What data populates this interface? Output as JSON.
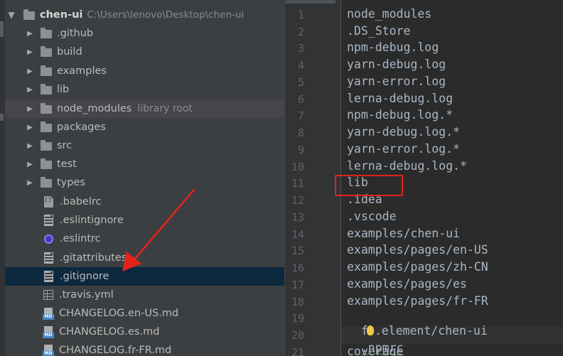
{
  "tree": {
    "root": {
      "name": "chen-ui",
      "path": "C:\\Users\\lenovo\\Desktop\\chen-ui"
    },
    "folders": [
      {
        "label": ".github"
      },
      {
        "label": "build"
      },
      {
        "label": "examples"
      },
      {
        "label": "lib"
      },
      {
        "label": "node_modules",
        "hint": "library root"
      },
      {
        "label": "packages"
      },
      {
        "label": "src"
      },
      {
        "label": "test"
      },
      {
        "label": "types"
      }
    ],
    "files": [
      {
        "label": ".babelrc",
        "icon": "babel-config-icon"
      },
      {
        "label": ".eslintignore",
        "icon": "text-file-icon"
      },
      {
        "label": ".eslintrc",
        "icon": "eslint-icon"
      },
      {
        "label": ".gitattributes",
        "icon": "text-file-icon"
      },
      {
        "label": ".gitignore",
        "icon": "text-file-icon",
        "selected": true
      },
      {
        "label": ".travis.yml",
        "icon": "yml-file-icon"
      },
      {
        "label": "CHANGELOG.en-US.md",
        "icon": "markdown-file-icon"
      },
      {
        "label": "CHANGELOG.es.md",
        "icon": "markdown-file-icon"
      },
      {
        "label": "CHANGELOG.fr-FR.md",
        "icon": "markdown-file-icon"
      }
    ],
    "markdown_badge": "MD"
  },
  "editor": {
    "line_numbers": [
      "1",
      "2",
      "3",
      "4",
      "5",
      "6",
      "7",
      "8",
      "9",
      "10",
      "11",
      "12",
      "13",
      "14",
      "15",
      "16",
      "17",
      "18",
      "19",
      "20",
      "21"
    ],
    "lines": [
      "node_modules",
      ".DS_Store",
      "npm-debug.log",
      "yarn-debug.log",
      "yarn-error.log",
      "lerna-debug.log",
      "npm-debug.log.*",
      "yarn-debug.log.*",
      "yarn-error.log.*",
      "lerna-debug.log.*",
      "lib",
      ".idea",
      ".vscode",
      "examples/chen-ui",
      "examples/pages/en-US",
      "examples/pages/zh-CN",
      "examples/pages/es",
      "examples/pages/fr-FR",
      "f",
      ".npmrc",
      "coverage"
    ],
    "line19_rest": ".element/chen-ui",
    "highlighted_line": 11
  },
  "colors": {
    "annotation_red": "#e2231a",
    "selection": "#0d293e",
    "code_text": "#a9b7c6"
  }
}
